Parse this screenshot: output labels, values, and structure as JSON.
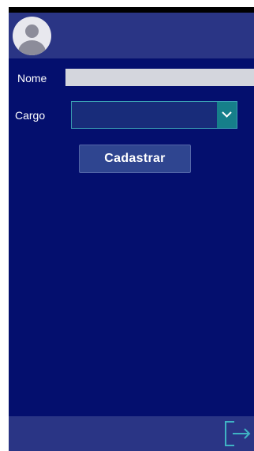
{
  "form": {
    "nome_label": "Nome",
    "nome_value": "",
    "cargo_label": "Cargo",
    "cargo_value": "",
    "submit_label": "Cadastrar"
  },
  "icons": {
    "avatar": "user-avatar-icon",
    "dropdown": "chevron-down-icon",
    "exit": "logout-icon"
  },
  "colors": {
    "background": "#040f6e",
    "header": "#2a3585",
    "accent": "#167f8a",
    "button": "#2f4590"
  }
}
